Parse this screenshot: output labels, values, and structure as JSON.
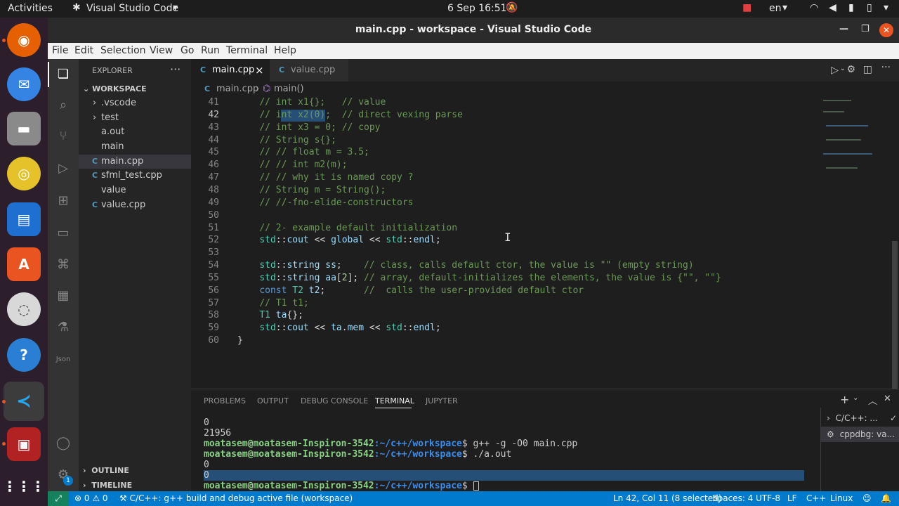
{
  "topbar": {
    "activities": "Activities",
    "app_name": "Visual Studio Code",
    "clock": "6 Sep  16:51",
    "lang": "en"
  },
  "window": {
    "title": "main.cpp - workspace - Visual Studio Code"
  },
  "menu": [
    "File",
    "Edit",
    "Selection",
    "View",
    "Go",
    "Run",
    "Terminal",
    "Help"
  ],
  "sidebar": {
    "title": "EXPLORER",
    "more": "···",
    "workspace": "WORKSPACE",
    "items": [
      {
        "label": ".vscode",
        "kind": "folder"
      },
      {
        "label": "test",
        "kind": "folder"
      },
      {
        "label": "a.out",
        "kind": "file"
      },
      {
        "label": "main",
        "kind": "file"
      },
      {
        "label": "main.cpp",
        "kind": "cpp",
        "active": true
      },
      {
        "label": "sfml_test.cpp",
        "kind": "cpp"
      },
      {
        "label": "value",
        "kind": "file"
      },
      {
        "label": "value.cpp",
        "kind": "cpp"
      }
    ],
    "outline": "OUTLINE",
    "timeline": "TIMELINE",
    "badge": "1"
  },
  "tabs": [
    {
      "label": "main.cpp",
      "close": "×",
      "icon": "C"
    },
    {
      "label": "value.cpp",
      "icon": "C"
    }
  ],
  "breadcrumb": {
    "file": "main.cpp",
    "symbol": "main()"
  },
  "editor": {
    "current_line": 42,
    "lines": [
      {
        "n": "41",
        "text": "    // int x1{};   // value"
      },
      {
        "n": "42",
        "text": "    // int x2(0);  // direct vexing parse"
      },
      {
        "n": "43",
        "text": "    // int x3 = 0; // copy"
      },
      {
        "n": "44",
        "text": "    // String s{};"
      },
      {
        "n": "45",
        "text": "    // // float m = 3.5;"
      },
      {
        "n": "46",
        "text": "    // // int m2(m);"
      },
      {
        "n": "47",
        "text": "    // // why it is named copy ?"
      },
      {
        "n": "48",
        "text": "    // String m = String();"
      },
      {
        "n": "49",
        "text": "    // //-fno-elide-constructors"
      },
      {
        "n": "50",
        "text": ""
      },
      {
        "n": "51",
        "text": "    // 2- example default initialization"
      },
      {
        "n": "52",
        "text": "    std::cout << global << std::endl;"
      },
      {
        "n": "53",
        "text": ""
      },
      {
        "n": "54",
        "text": "    std::string ss;    // class, calls default ctor, the value is \"\" (empty string)"
      },
      {
        "n": "55",
        "text": "    std::string aa[2]; // array, default-initializes the elements, the value is {\"\", \"\"}"
      },
      {
        "n": "56",
        "text": "    const T2 t2;       //  calls the user-provided default ctor"
      },
      {
        "n": "57",
        "text": "    // T1 t1;"
      },
      {
        "n": "58",
        "text": "    T1 ta{};"
      },
      {
        "n": "59",
        "text": "    std::cout << ta.mem << std::endl;"
      },
      {
        "n": "60",
        "text": "}"
      }
    ]
  },
  "panel": {
    "tabs": [
      "PROBLEMS",
      "OUTPUT",
      "DEBUG CONSOLE",
      "TERMINAL",
      "JUPYTER"
    ],
    "active_tab": "TERMINAL",
    "terminal": [
      {
        "out": "0"
      },
      {
        "out": "21956"
      },
      {
        "user": "moatasem@moatasem-Inspiron-3542",
        "path": ":~/c++/workspace",
        "cmd": "$ g++ -g -O0 main.cpp"
      },
      {
        "user": "moatasem@moatasem-Inspiron-3542",
        "path": ":~/c++/workspace",
        "cmd": "$ ./a.out"
      },
      {
        "out": "0"
      },
      {
        "out": "0"
      },
      {
        "user": "moatasem@moatasem-Inspiron-3542",
        "path": ":~/c++/workspace",
        "cmd": "$ "
      }
    ],
    "terminal_list": [
      {
        "label": "C/C++: ..."
      },
      {
        "label": "cppdbg: va..."
      }
    ]
  },
  "statusbar": {
    "errors": "0",
    "warnings": "0",
    "task": "C/C++: g++ build and debug active file (workspace)",
    "position": "Ln 42, Col 11 (8 selected)",
    "spaces": "Spaces: 4",
    "encoding": "UTF-8",
    "eol": "LF",
    "language": "C++",
    "os": "Linux"
  },
  "colors": {
    "accent": "#007acc",
    "comment": "#6a9955",
    "namespace": "#4ec9b0",
    "variable": "#9cdcfe",
    "keyword": "#569cd6",
    "ubuntu_orange": "#e95420"
  }
}
